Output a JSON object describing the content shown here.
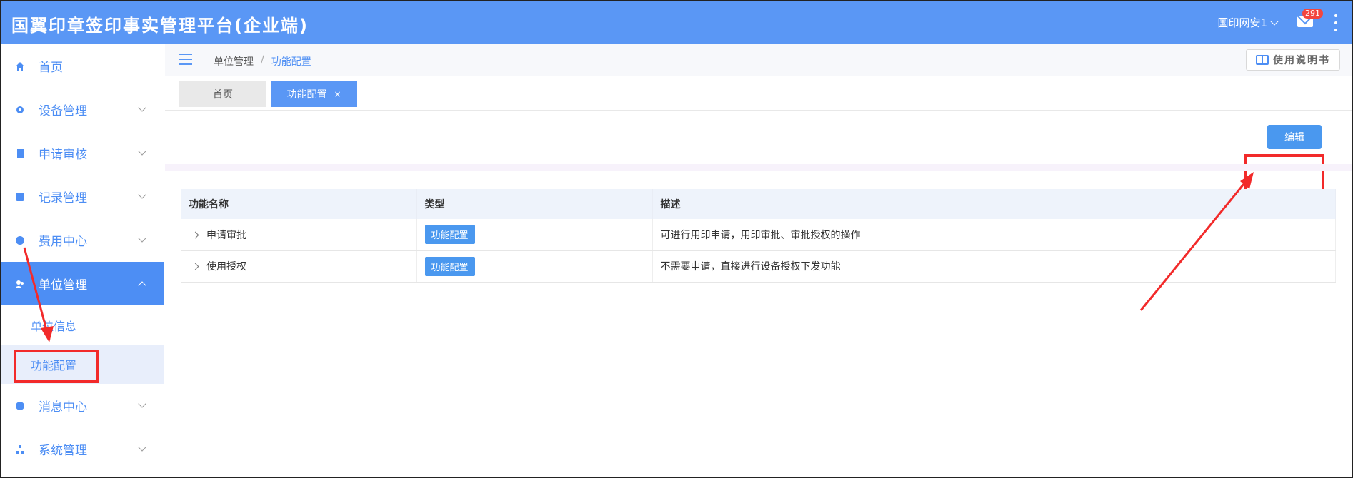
{
  "header": {
    "title": "国翼印章签印事实管理平台(企业端)",
    "user": "国印网安1",
    "mail_badge": "291"
  },
  "sidebar": {
    "items": [
      {
        "label": "首页"
      },
      {
        "label": "设备管理"
      },
      {
        "label": "申请审核"
      },
      {
        "label": "记录管理"
      },
      {
        "label": "费用中心"
      },
      {
        "label": "单位管理"
      },
      {
        "label": "消息中心"
      },
      {
        "label": "系统管理"
      }
    ],
    "sub_items": [
      {
        "label": "单位信息"
      },
      {
        "label": "功能配置"
      }
    ]
  },
  "breadcrumb": {
    "parent": "单位管理",
    "separator": "/",
    "current": "功能配置"
  },
  "manual_button": "使用说明书",
  "tabs": {
    "home": "首页",
    "active": "功能配置",
    "close": "×"
  },
  "edit_button": "编辑",
  "table": {
    "headers": [
      "功能名称",
      "类型",
      "描述"
    ],
    "rows": [
      {
        "name": "申请审批",
        "type": "功能配置",
        "description": "可进行用印申请，用印审批、审批授权的操作"
      },
      {
        "name": "使用授权",
        "type": "功能配置",
        "description": "不需要申请，直接进行设备授权下发功能"
      }
    ]
  },
  "colors": {
    "primary": "#5a97f5",
    "annotation": "#f22a2a"
  }
}
